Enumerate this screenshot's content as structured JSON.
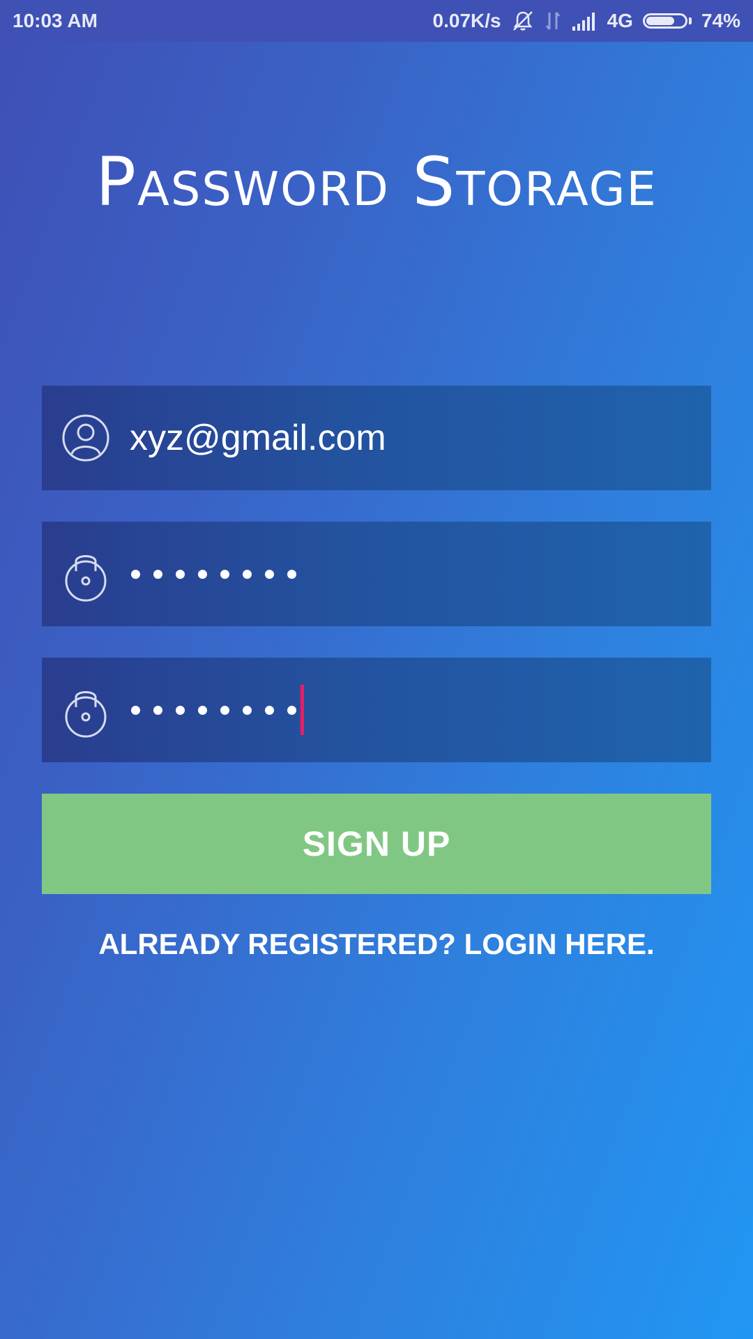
{
  "status_bar": {
    "time": "10:03 AM",
    "network_speed": "0.07K/s",
    "network_type": "4G",
    "battery_percent": "74%",
    "battery_level": 0.74,
    "icons": [
      "vibrate-off-icon",
      "data-arrows-icon",
      "signal-icon",
      "battery-icon"
    ]
  },
  "app": {
    "title": "Password Storage"
  },
  "form": {
    "email": {
      "value": "xyz@gmail.com",
      "icon": "user-icon"
    },
    "password": {
      "masked_length": 8,
      "icon": "lock-icon"
    },
    "confirm_password": {
      "masked_length": 8,
      "icon": "lock-icon",
      "focused": true
    },
    "signup_label": "SIGN UP",
    "login_link_label": "ALREADY REGISTERED? LOGIN HERE."
  },
  "colors": {
    "status_bar": "#3f51b5",
    "button": "#81c784",
    "cursor": "#e91e63",
    "gradient_start": "#3f4fb5",
    "gradient_end": "#2196f3"
  }
}
